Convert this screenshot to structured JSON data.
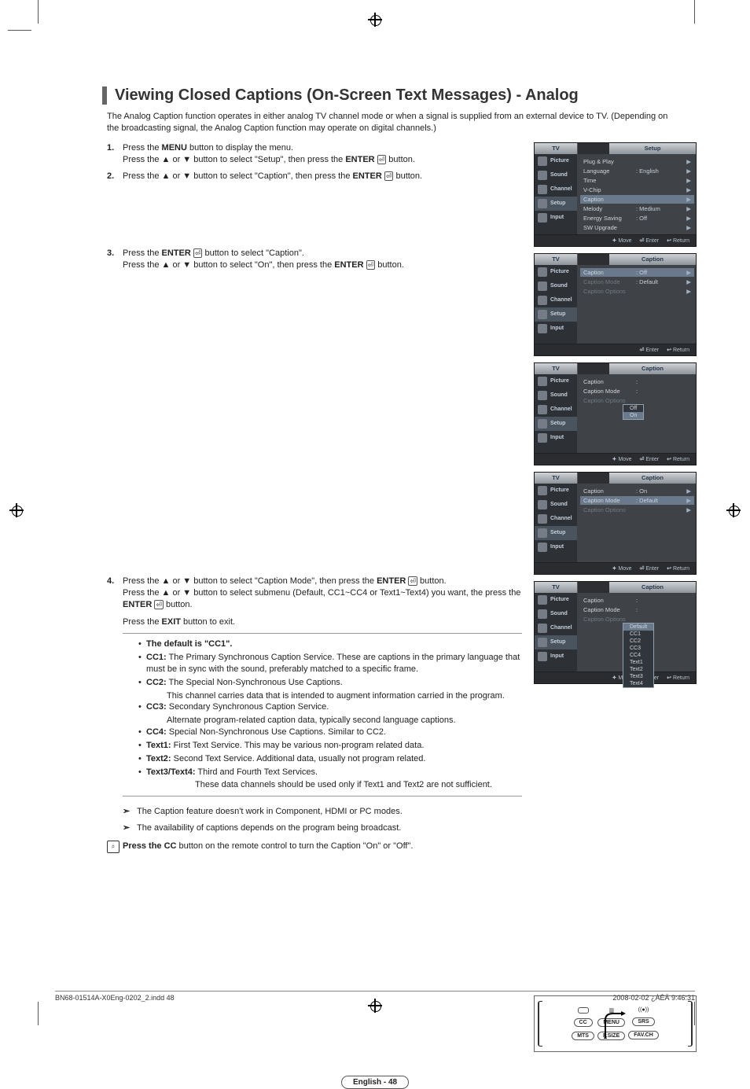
{
  "title": "Viewing Closed Captions (On-Screen Text Messages) - Analog",
  "intro": "The Analog Caption function operates in either analog TV channel mode or when a signal is supplied from an external device to TV. (Depending on the broadcasting signal, the Analog Caption function may operate on digital channels.)",
  "steps": {
    "s1a": "Press the ",
    "s1a_b": "MENU",
    "s1a2": " button to display the menu.",
    "s1b": "Press the ▲ or ▼ button to select \"Setup\", then press the ",
    "s1b_b": "ENTER",
    "s1b2": " button.",
    "s2": "Press the ▲ or ▼ button to select \"Caption\", then press the ",
    "s2_b": "ENTER",
    "s2_2": " button.",
    "s3a": "Press the ",
    "s3a_b": "ENTER",
    "s3a2": " button to select \"Caption\".",
    "s3b": "Press the ▲ or ▼ button to select \"On\", then press the ",
    "s3b_b": "ENTER",
    "s3b2": " button.",
    "s4a": "Press the ▲ or ▼ button to select \"Caption Mode\", then press the ",
    "s4a_b": "ENTER",
    "s4a2": " button.",
    "s4b": "Press the ▲ or ▼ button to select submenu (Default, CC1~CC4 or Text1~Text4) you want, the press the ",
    "s4b_b": "ENTER",
    "s4b2": " button.",
    "s4c": "Press the ",
    "s4c_b": "EXIT",
    "s4c2": " button to exit."
  },
  "default_note": "The default is \"CC1\".",
  "bullets": {
    "cc1_h": "CC1:",
    "cc1_t": " The Primary Synchronous Caption Service. These are captions in the primary language that must be in sync with the sound, preferably matched to a specific frame.",
    "cc2_h": "CC2:",
    "cc2_t": " The Special Non-Synchronous Use Captions.",
    "cc2_c": "This channel carries data that is intended to augment information carried in the program.",
    "cc3_h": "CC3:",
    "cc3_t": " Secondary Synchronous Caption Service.",
    "cc3_c": "Alternate program-related caption data, typically second language captions.",
    "cc4_h": "CC4:",
    "cc4_t": " Special Non-Synchronous Use Captions. Similar to CC2.",
    "t1_h": "Text1:",
    "t1_t": " First Text Service. This may be various non-program related data.",
    "t2_h": "Text2:",
    "t2_t": " Second Text Service. Additional data, usually not program related.",
    "t34_h": "Text3/Text4:",
    "t34_t": " Third and Fourth Text Services.",
    "t34_c": "These data channels should be used only if Text1 and Text2 are not sufficient."
  },
  "notes": {
    "n1": "The Caption feature doesn't work in Component, HDMI or PC modes.",
    "n2": "The availability of captions depends on the program being broadcast."
  },
  "cc_press": {
    "a": "Press the CC",
    "b": " button on the remote control to turn the Caption \"On\" or \"Off\"."
  },
  "page_label": "English - 48",
  "footer": {
    "left": "BN68-01514A-X0Eng-0202_2.indd   48",
    "right": "2008-02-02   ¿ÀÈÄ 9:46:31"
  },
  "osd": {
    "tv": "TV",
    "side": [
      "Picture",
      "Sound",
      "Channel",
      "Setup",
      "Input"
    ],
    "foot": {
      "move": "Move",
      "enter": "Enter",
      "return": "Return"
    },
    "screen1": {
      "title": "Setup",
      "rows": [
        {
          "l": "Plug & Play",
          "v": "",
          "a": "▶"
        },
        {
          "l": "Language",
          "v": ": English",
          "a": "▶"
        },
        {
          "l": "Time",
          "v": "",
          "a": "▶"
        },
        {
          "l": "V-Chip",
          "v": "",
          "a": "▶"
        },
        {
          "l": "Caption",
          "v": "",
          "a": "▶",
          "hl": true
        },
        {
          "l": "Melody",
          "v": ": Medium",
          "a": "▶"
        },
        {
          "l": "Energy Saving",
          "v": ": Off",
          "a": "▶"
        },
        {
          "l": "SW Upgrade",
          "v": "",
          "a": "▶"
        }
      ]
    },
    "screen2": {
      "title": "Caption",
      "rows": [
        {
          "l": "Caption",
          "v": ": Off",
          "a": "▶",
          "hl": true
        },
        {
          "l": "Caption Mode",
          "v": ": Default",
          "a": "▶",
          "dim": true
        },
        {
          "l": "Caption Options",
          "v": "",
          "a": "▶",
          "dim": true
        }
      ]
    },
    "screen3": {
      "title": "Caption",
      "rows": [
        {
          "l": "Caption",
          "v": ":",
          "a": ""
        },
        {
          "l": "Caption Mode",
          "v": ":",
          "a": "",
          "dim": false
        },
        {
          "l": "Caption Options",
          "v": "",
          "a": "",
          "dim": true
        }
      ],
      "popup": [
        "Off",
        "On"
      ],
      "popup_sel": 1
    },
    "screen4": {
      "title": "Caption",
      "rows": [
        {
          "l": "Caption",
          "v": ": On",
          "a": "▶"
        },
        {
          "l": "Caption Mode",
          "v": ": Default",
          "a": "▶",
          "hl": true
        },
        {
          "l": "Caption Options",
          "v": "",
          "a": "▶",
          "dim": true
        }
      ]
    },
    "screen5": {
      "title": "Caption",
      "rows": [
        {
          "l": "Caption",
          "v": ":",
          "a": ""
        },
        {
          "l": "Caption Mode",
          "v": ":",
          "a": ""
        },
        {
          "l": "Caption Options",
          "v": "",
          "a": "",
          "dim": true
        }
      ],
      "popup": [
        "Default",
        "CC1",
        "CC2",
        "CC3",
        "CC4",
        "Text1",
        "Text2",
        "Text3",
        "Text4"
      ],
      "popup_sel": 0
    }
  },
  "remote": {
    "cc": "CC",
    "menu": "MENU",
    "srs": "SRS",
    "mts": "MTS",
    "psize": "P.SIZE",
    "fav": "FAV.CH"
  }
}
